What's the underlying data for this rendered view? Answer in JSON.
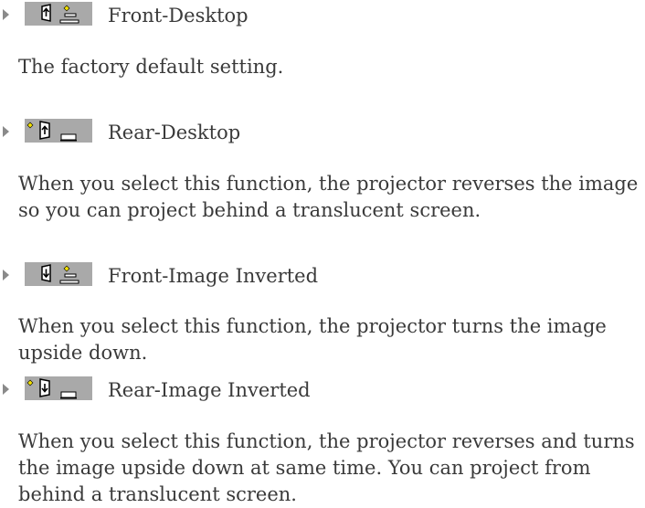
{
  "entries": [
    {
      "icon": "front-desktop-icon",
      "title": "Front-Desktop",
      "description": "The factory default setting."
    },
    {
      "icon": "rear-desktop-icon",
      "title": "Rear-Desktop",
      "description": "When you select this function, the projector reverses the image\nso you can project behind a translucent screen."
    },
    {
      "icon": "front-image-inverted-icon",
      "title": "Front-Image Inverted",
      "description": "When you select this function, the projector turns the image\nupside down."
    },
    {
      "icon": "rear-image-inverted-icon",
      "title": "Rear-Image Inverted",
      "description": "When you select this function, the projector reverses and turns\nthe image upside down at same time. You can project from\nbehind a translucent screen."
    }
  ]
}
